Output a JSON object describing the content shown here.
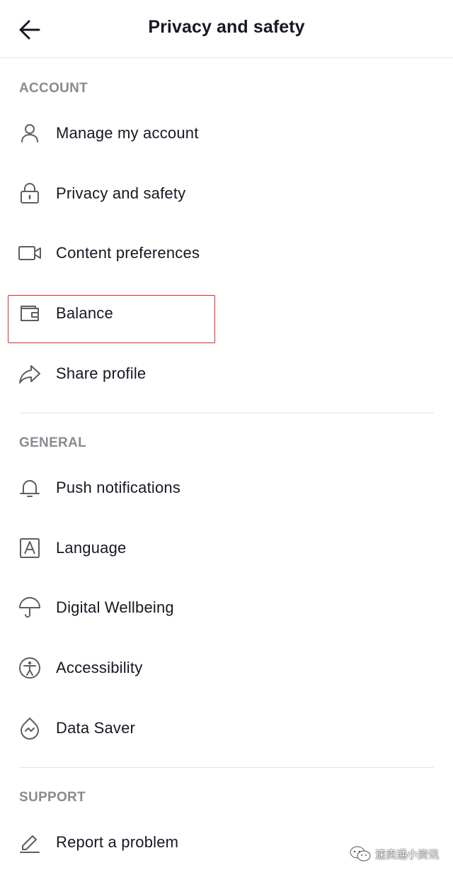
{
  "header": {
    "title": "Privacy and safety",
    "back_icon": "arrow-left-icon"
  },
  "sections": {
    "account": {
      "title": "ACCOUNT",
      "items": [
        {
          "label": "Manage my account",
          "icon": "person-icon"
        },
        {
          "label": "Privacy and safety",
          "icon": "lock-icon"
        },
        {
          "label": "Content preferences",
          "icon": "video-camera-icon"
        },
        {
          "label": "Balance",
          "icon": "wallet-icon"
        },
        {
          "label": "Share profile",
          "icon": "share-arrow-icon"
        }
      ]
    },
    "general": {
      "title": "GENERAL",
      "items": [
        {
          "label": "Push notifications",
          "icon": "bell-icon"
        },
        {
          "label": "Language",
          "icon": "letter-a-icon"
        },
        {
          "label": "Digital Wellbeing",
          "icon": "umbrella-icon"
        },
        {
          "label": "Accessibility",
          "icon": "accessibility-icon"
        },
        {
          "label": "Data Saver",
          "icon": "data-saver-icon"
        }
      ]
    },
    "support": {
      "title": "SUPPORT",
      "items": [
        {
          "label": "Report a problem",
          "icon": "pencil-icon"
        }
      ]
    }
  },
  "watermark": {
    "text": "速卖通小资讯"
  },
  "colors": {
    "text_primary": "#161823",
    "section_title": "#8a8b91",
    "divider": "#e3e3e4",
    "highlight": "#e0252a"
  }
}
